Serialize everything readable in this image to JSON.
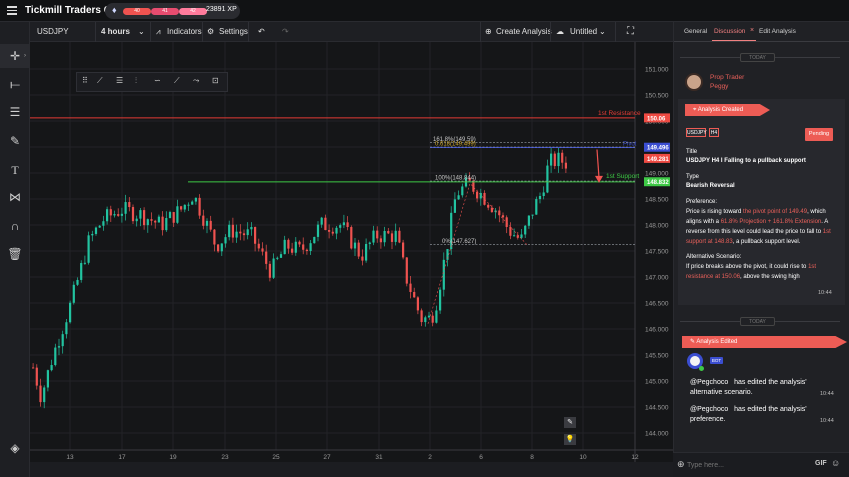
{
  "app": {
    "title": "Tickmill Traders Club"
  },
  "stats": {
    "badge_1": "40",
    "badge_2": "41",
    "badge_3": "42",
    "xp": "23891 XP"
  },
  "toolbar": {
    "symbol": "USDJPY",
    "timeframe": "4 hours",
    "indicators": "Indicators",
    "settings": "Settings",
    "create": "Create Analysis",
    "untitled": "Untitled"
  },
  "panel": {
    "tabs": [
      "General",
      "Discussion",
      "Edit Analysis"
    ],
    "today": "TODAY",
    "author_role": "Prop Trader",
    "author_name": "Peggy",
    "created_label": "Analysis Created",
    "tags": [
      "USDJPY",
      "H4"
    ],
    "status": "Pending",
    "title_label": "Title",
    "title_value": "USDJPY H4 I Falling to a pullback support",
    "type_label": "Type",
    "type_value": "Bearish Reversal",
    "pref_label": "Preference:",
    "pref_1": "Price is rising toward",
    "pref_2": "the pivot point of 149.49",
    "pref_3": ", which",
    "pref_4": "aligns with a",
    "pref_5": "61.8% Projection + 161.8% Extension",
    "pref_6": ". A",
    "pref_7": "reverse from this level could lead the price to fall to",
    "pref_8": "1st",
    "pref_9": "support at 148.83",
    "pref_10": ", a pullback support level.",
    "alt_label": "Alternative Scenario:",
    "alt_1": "If price breaks above the pivot, it could rise to",
    "alt_2": "1st",
    "alt_3": "resistance at 150.06",
    "alt_4": ", above the swing high",
    "time_1": "10:44",
    "today_2": "TODAY",
    "edited_label": "Analysis Edited",
    "bot_badge": "BOT",
    "msg1_user": "@Pegchoco",
    "msg1_text": "has edited the analysis'",
    "msg1_text2": "alternative scenario.",
    "msg1_time": "10:44",
    "msg2_user": "@Pegchoco",
    "msg2_text": "has edited the analysis'",
    "msg2_text2": "preference.",
    "msg2_time": "10:44",
    "input_placeholder": "Type here...",
    "gif": "GIF"
  },
  "chart_data": {
    "type": "candlestick",
    "y_ticks": [
      "151.000",
      "150.500",
      "150.000",
      "149.500",
      "149.000",
      "148.500",
      "148.000",
      "147.500",
      "147.000",
      "146.500",
      "146.000",
      "145.500",
      "145.000",
      "144.500",
      "144.000"
    ],
    "x_ticks": [
      "13",
      "17",
      "19",
      "23",
      "25",
      "27",
      "31",
      "2",
      "6",
      "8",
      "10",
      "12"
    ],
    "price_tags": [
      {
        "value": "150.06",
        "color": "#ee4b43"
      },
      {
        "value": "149.496",
        "color": "#3b4ed1"
      },
      {
        "value": "149.281",
        "color": "#ee4b43"
      },
      {
        "value": "148.832",
        "color": "#3ec946"
      }
    ],
    "levels": [
      {
        "name": "1st Resistance",
        "value": 150.06,
        "color": "#e33b34"
      },
      {
        "name": "1st Support",
        "value": 148.83,
        "color": "#3ec946"
      },
      {
        "name": "Pivot",
        "value": 149.49,
        "color": "#3b4ed1"
      }
    ],
    "fib_labels": [
      "161.8%(149.59)",
      "0.618(149.499)",
      "100%(148.844)",
      "0%(147.627)"
    ],
    "ylim": [
      143.5,
      151.3
    ]
  },
  "colors": {
    "up": "#22c3a0",
    "down": "#ef5350",
    "accent": "#ed5c55"
  }
}
